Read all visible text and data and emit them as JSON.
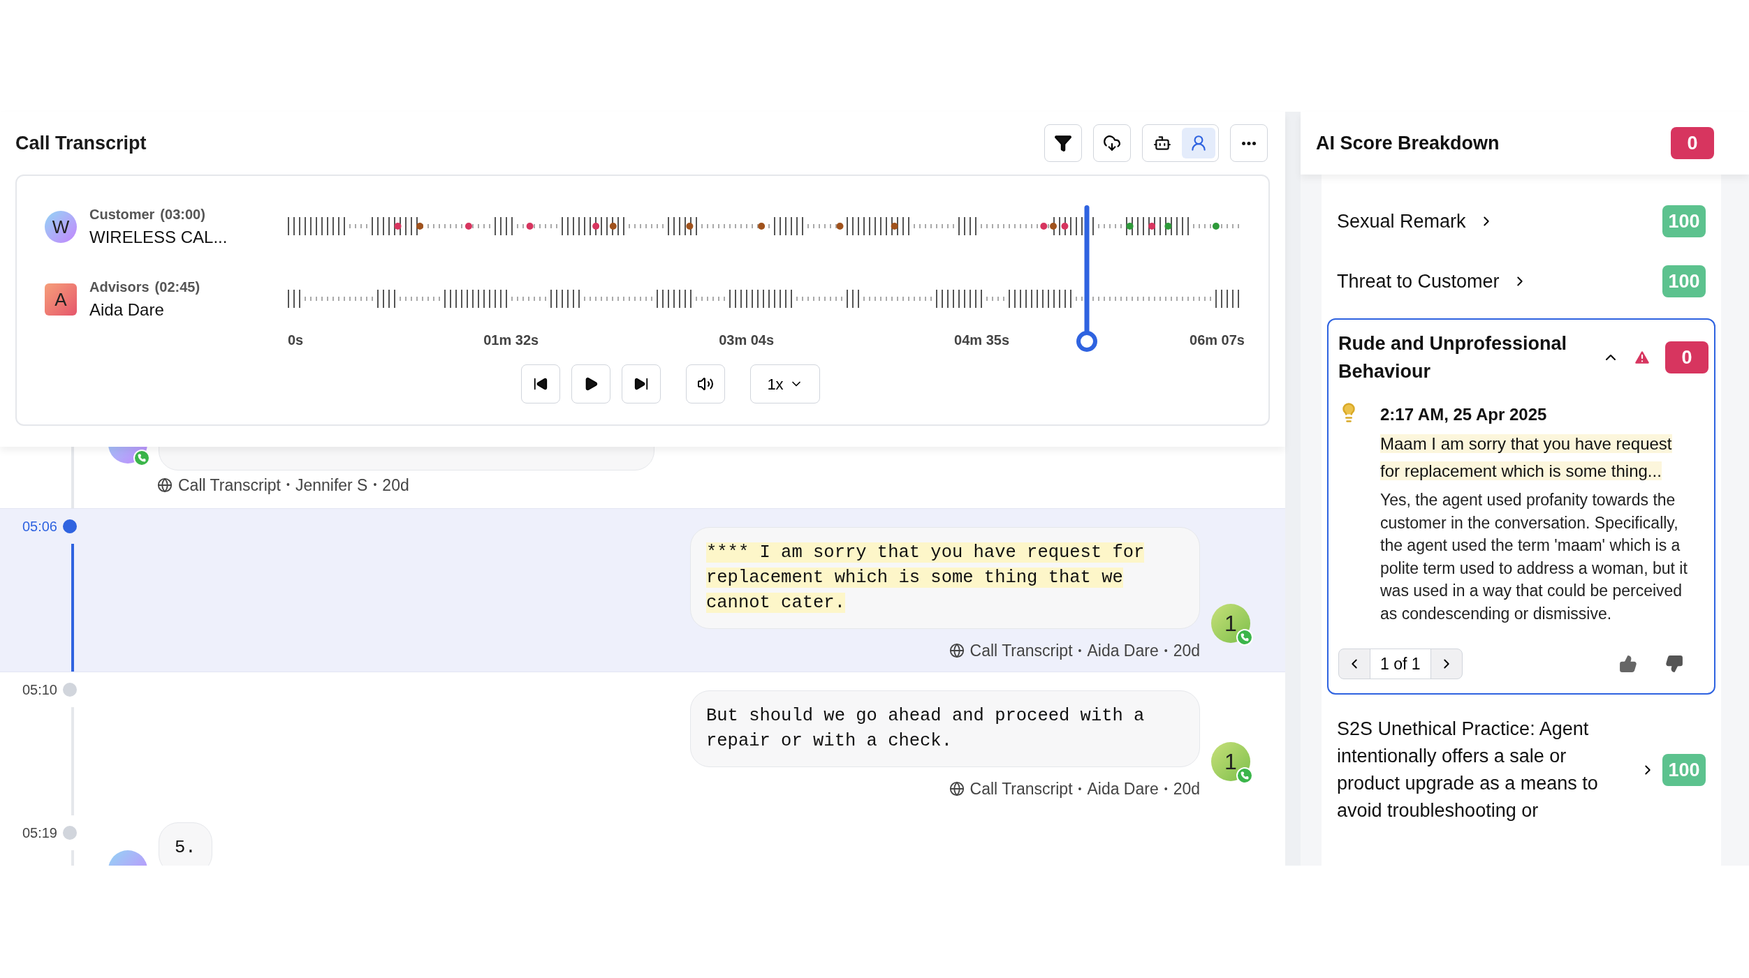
{
  "transcript": {
    "title": "Call Transcript",
    "views": [
      {
        "kind": "bot",
        "selected": false
      },
      {
        "kind": "agent",
        "selected": true
      }
    ],
    "speakers": [
      {
        "initial": "W",
        "kind": "customer",
        "role": "Customer",
        "duration": "(03:00)",
        "name": "WIRELESS CAL..."
      },
      {
        "initial": "A",
        "kind": "advisor",
        "role": "Advisors",
        "duration": "(02:45)",
        "name": "Aida Dare"
      }
    ],
    "timeline": [
      "0s",
      "01m 32s",
      "03m 04s",
      "04m 35s",
      "06m 07s"
    ],
    "playback": {
      "level": 0.835,
      "speed": "1x"
    },
    "messages": [
      {
        "kind": "customer_tail",
        "selected": false,
        "source": "Call Transcript",
        "separators": [
          "•",
          "•"
        ],
        "author": "Jennifer S",
        "age": "20d"
      },
      {
        "kind": "agent",
        "time": "05:06",
        "selected": true,
        "highlighted": true,
        "avatar": "1",
        "text": "**** I am sorry that you have request for replacement which is some thing that we cannot cater.",
        "source": "Call Transcript",
        "separators": [
          "•",
          "•"
        ],
        "author": "Aida Dare",
        "age": "20d"
      },
      {
        "kind": "agent",
        "time": "05:10",
        "selected": false,
        "highlighted": false,
        "avatar": "1",
        "text": "But should we go ahead and proceed with a repair or with a check.",
        "source": "Call Transcript",
        "separators": [
          "•",
          "•"
        ],
        "author": "Aida Dare",
        "age": "20d"
      },
      {
        "kind": "customer_head",
        "time": "05:19",
        "selected": false,
        "highlighted": false,
        "text": "5."
      }
    ]
  },
  "breakdown": {
    "title": "AI Score Breakdown",
    "score": "0",
    "color": "#d7355f",
    "items": [
      {
        "label": "Sexual Remark",
        "score": "100",
        "color": "#5cc28e",
        "expanded": false,
        "flagged": false
      },
      {
        "label": "Threat to Customer",
        "score": "100",
        "color": "#5cc28e",
        "expanded": false,
        "flagged": false
      },
      {
        "label": "Rude and Unprofessional Behaviour",
        "score": "0",
        "color": "#d7355f",
        "expanded": true,
        "flagged": true,
        "detail": {
          "timestamp": "2:17 AM, 25 Apr 2025",
          "quote": "Maam I am sorry that you have request for replacement which is some thing...",
          "explanation": "Yes, the agent used profanity towards the customer in the conversation. Specifically, the agent used the term 'maam' which is a polite term used to address a woman, but it was used in a way that could be perceived as condescending or dismissive.",
          "pager": "1 of 1"
        }
      },
      {
        "label": "S2S Unethical Practice: Agent intentionally offers a sale or product upgrade as a means to avoid troubleshooting or",
        "score": "100",
        "color": "#5cc28e",
        "expanded": false,
        "flagged": false
      }
    ]
  }
}
